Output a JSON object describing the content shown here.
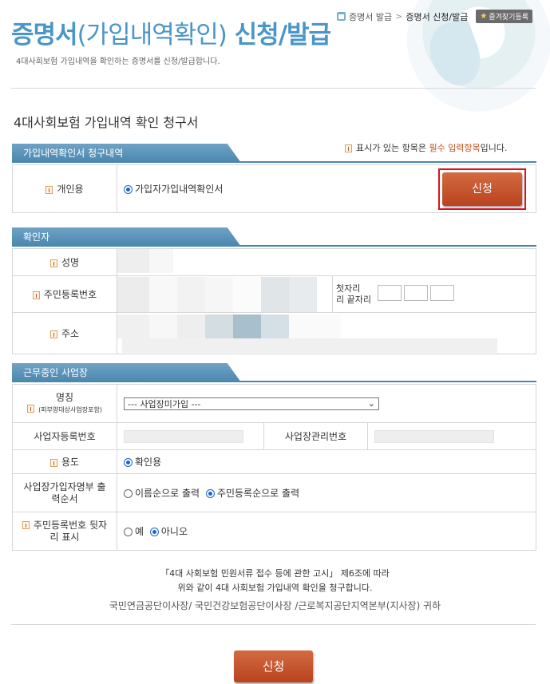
{
  "header": {
    "title_main": "증명서",
    "title_paren": "(가입내역확인)",
    "title_rest": " 신청/발급",
    "description": "4대사회보험 가입내역을 확인하는 증명서를 신청/발급합니다.",
    "breadcrumb": [
      "증명서 발급",
      "증명서 신청/발급"
    ],
    "favorite_label": "즐겨찾기등록"
  },
  "form": {
    "title": "4대사회보험 가입내역 확인 청구서",
    "notice_prefix": "표시가 있는 항목은",
    "notice_em": "필수 입력항목",
    "notice_suffix": "입니다."
  },
  "section1": {
    "header": "가입내역확인서 청구내역",
    "row_label": "개인용",
    "radio_label": "가입자가입내역확인서",
    "apply_button": "신청"
  },
  "section2": {
    "header": "확인자",
    "name_label": "성명",
    "ssn_label": "주민등록번호",
    "ssn_hint_1": "첫자리",
    "ssn_hint_2": "리 끝자리",
    "address_label": "주소"
  },
  "section3": {
    "header": "근무중인 사업장",
    "name_label": "명칭",
    "name_sublabel": "(피부양대상사업장포함)",
    "workplace_select": "--- 사업장미가입 ---",
    "biz_reg_label": "사업자등록번호",
    "workplace_mgmt_label": "사업장관리번호",
    "purpose_label": "용도",
    "purpose_option": "확인용",
    "print_order_label": "사업장가입자명부 출력순서",
    "print_order_options": [
      "이름순으로 출력",
      "주민등록순으로 출력"
    ],
    "print_order_selected": "주민등록순으로 출력",
    "ssn_display_label": "주민등록번호 뒷자리 표시",
    "ssn_display_options": [
      "예",
      "아니오"
    ],
    "ssn_display_selected": "아니오"
  },
  "closing": {
    "line1": "「4대 사회보험 민원서류 접수 등에 관한 고시」 제6조에 따라",
    "line2": "위와 같이 4대 사회보험 가입내역 확인을 청구합니다.",
    "agencies": "국민연금공단이사장/ 국민건강보험공단이사장 /근로복지공단지역본부(지사장) 귀하"
  },
  "bottom_button": "신청",
  "colors": {
    "title_blue": "#4a96c8",
    "section_header": "#4a86ad",
    "apply_button": "#b8431f",
    "highlight_outline": "#e0101a",
    "required_text": "#c05020"
  }
}
